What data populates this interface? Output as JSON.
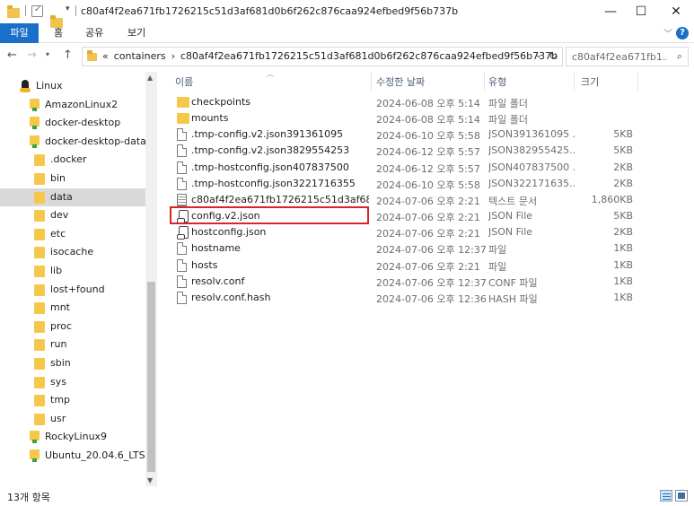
{
  "window": {
    "title": "c80af4f2ea671fb1726215c51d3af681d0b6f262c876caa924efbed9f56b737b",
    "minimize_glyph": "—",
    "maximize_glyph": "☐",
    "close_glyph": "✕"
  },
  "ribbon": {
    "file_tab": "파일",
    "tabs": [
      "홈",
      "공유",
      "보기"
    ],
    "help_glyph": "?"
  },
  "address": {
    "overflow": "«",
    "crumbs": [
      "containers",
      "c80af4f2ea671fb1726215c51d3af681d0b6f262c876caa924efbed9f56b737b"
    ],
    "separator": "›"
  },
  "search": {
    "placeholder": "c80af4f2ea671fb1..."
  },
  "sidebar": {
    "items": [
      {
        "label": "Linux",
        "kind": "linux-root"
      },
      {
        "label": "AmazonLinux2",
        "kind": "distro"
      },
      {
        "label": "docker-desktop",
        "kind": "distro"
      },
      {
        "label": "docker-desktop-data",
        "kind": "distro"
      },
      {
        "label": ".docker",
        "kind": "folder"
      },
      {
        "label": "bin",
        "kind": "folder"
      },
      {
        "label": "data",
        "kind": "folder",
        "selected": true
      },
      {
        "label": "dev",
        "kind": "folder"
      },
      {
        "label": "etc",
        "kind": "folder"
      },
      {
        "label": "isocache",
        "kind": "folder"
      },
      {
        "label": "lib",
        "kind": "folder"
      },
      {
        "label": "lost+found",
        "kind": "folder"
      },
      {
        "label": "mnt",
        "kind": "folder"
      },
      {
        "label": "proc",
        "kind": "folder"
      },
      {
        "label": "run",
        "kind": "folder"
      },
      {
        "label": "sbin",
        "kind": "folder"
      },
      {
        "label": "sys",
        "kind": "folder"
      },
      {
        "label": "tmp",
        "kind": "folder"
      },
      {
        "label": "usr",
        "kind": "folder"
      },
      {
        "label": "RockyLinux9",
        "kind": "distro"
      },
      {
        "label": "Ubuntu_20.04.6_LTS",
        "kind": "distro"
      }
    ]
  },
  "columns": {
    "name": "이름",
    "date": "수정한 날짜",
    "type": "유형",
    "size": "크기"
  },
  "files": [
    {
      "name": "checkpoints",
      "date": "2024-06-08 오후 5:14",
      "type": "파일 폴더",
      "size": "",
      "icon": "folder"
    },
    {
      "name": "mounts",
      "date": "2024-06-08 오후 5:14",
      "type": "파일 폴더",
      "size": "",
      "icon": "folder"
    },
    {
      "name": ".tmp-config.v2.json391361095",
      "date": "2024-06-10 오후 5:58",
      "type": "JSON391361095 ...",
      "size": "5KB",
      "icon": "file"
    },
    {
      "name": ".tmp-config.v2.json3829554253",
      "date": "2024-06-12 오후 5:57",
      "type": "JSON382955425...",
      "size": "5KB",
      "icon": "file"
    },
    {
      "name": ".tmp-hostconfig.json407837500",
      "date": "2024-06-12 오후 5:57",
      "type": "JSON407837500 ...",
      "size": "2KB",
      "icon": "file"
    },
    {
      "name": ".tmp-hostconfig.json3221716355",
      "date": "2024-06-10 오후 5:58",
      "type": "JSON322171635...",
      "size": "2KB",
      "icon": "file"
    },
    {
      "name": "c80af4f2ea671fb1726215c51d3af681d...",
      "date": "2024-07-06 오후 2:21",
      "type": "텍스트 문서",
      "size": "1,860KB",
      "icon": "text"
    },
    {
      "name": "config.v2.json",
      "date": "2024-07-06 오후 2:21",
      "type": "JSON File",
      "size": "5KB",
      "icon": "script",
      "highlighted": true
    },
    {
      "name": "hostconfig.json",
      "date": "2024-07-06 오후 2:21",
      "type": "JSON File",
      "size": "2KB",
      "icon": "script"
    },
    {
      "name": "hostname",
      "date": "2024-07-06 오후 12:37",
      "type": "파일",
      "size": "1KB",
      "icon": "file"
    },
    {
      "name": "hosts",
      "date": "2024-07-06 오후 2:21",
      "type": "파일",
      "size": "1KB",
      "icon": "file"
    },
    {
      "name": "resolv.conf",
      "date": "2024-07-06 오후 12:37",
      "type": "CONF 파일",
      "size": "1KB",
      "icon": "file"
    },
    {
      "name": "resolv.conf.hash",
      "date": "2024-07-06 오후 12:36",
      "type": "HASH 파일",
      "size": "1KB",
      "icon": "file"
    }
  ],
  "status": {
    "item_count": "13개 항목"
  },
  "colors": {
    "accent": "#1a6fc9",
    "highlight_box": "#d9242b",
    "selected_nav": "#d9d9d9"
  }
}
